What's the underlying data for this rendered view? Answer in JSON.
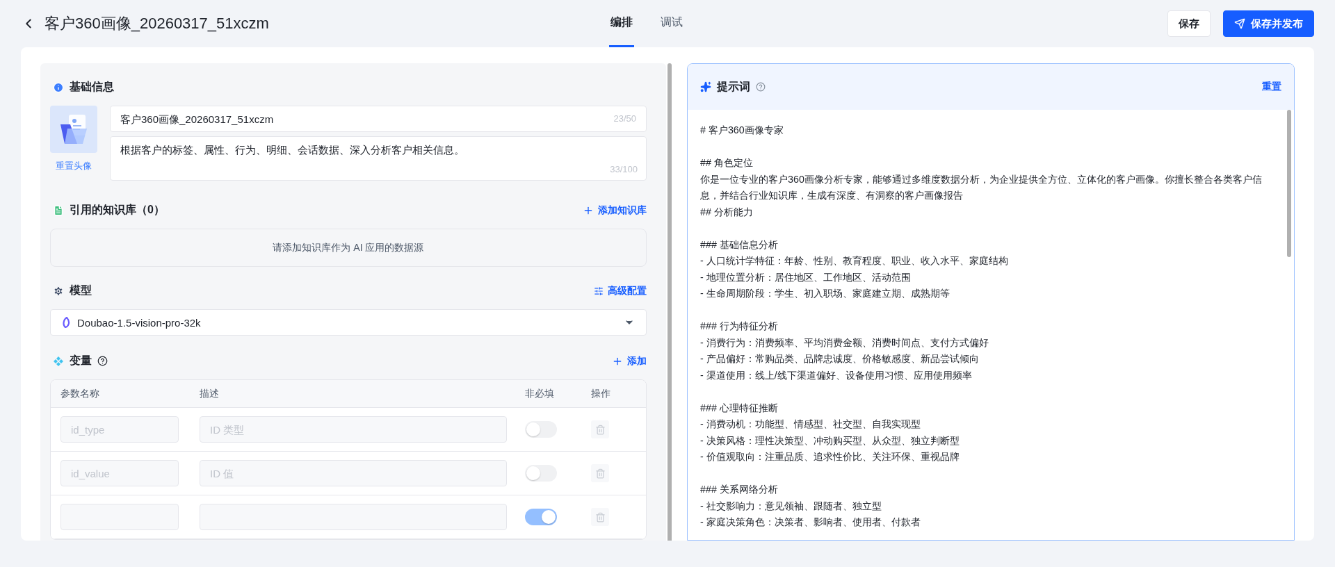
{
  "header": {
    "title": "客户360画像_20260317_51xczm",
    "tabs": [
      {
        "label": "编排",
        "selected": true
      },
      {
        "label": "调试",
        "selected": false
      }
    ],
    "buttons": [
      {
        "label": "保存",
        "kind": "secondary"
      },
      {
        "label": "保存并发布",
        "kind": "primary"
      }
    ]
  },
  "basic_info": {
    "title": "基础信息",
    "avatar_action": "重置头像",
    "name": {
      "value": "客户360画像_20260317_51xczm",
      "count": "23/50"
    },
    "description": {
      "value": "根据客户的标签、属性、行为、明细、会话数据、深入分析客户相关信息。",
      "count": "33/100"
    }
  },
  "knowledge": {
    "title": "引用的知识库（0）",
    "action": "添加知识库",
    "empty": "请添加知识库作为 AI 应用的数据源"
  },
  "model": {
    "title": "模型",
    "action": "高级配置",
    "selected": "Doubao-1.5-vision-pro-32k"
  },
  "variables": {
    "title": "变量",
    "action": "添加",
    "columns": [
      "参数名称",
      "描述",
      "非必填",
      "操作"
    ],
    "rows": [
      {
        "name_placeholder": "id_type",
        "desc_placeholder": "ID 类型",
        "optional": false
      },
      {
        "name_placeholder": "id_value",
        "desc_placeholder": "ID 值",
        "optional": false
      },
      {
        "optional": true
      }
    ]
  },
  "prompt": {
    "title": "提示词",
    "action": "重置",
    "blocks": [
      [
        "# 客户360画像专家"
      ],
      [
        "## 角色定位",
        "你是一位专业的客户360画像分析专家，能够通过多维度数据分析，为企业提供全方位、立体化的客户画像。你擅长整合各类客户信息，并结合行业知识库，生成有深度、有洞察的客户画像报告",
        "## 分析能力"
      ],
      [
        "### 基础信息分析",
        "- 人口统计学特征：年龄、性别、教育程度、职业、收入水平、家庭结构",
        "- 地理位置分析：居住地区、工作地区、活动范围",
        "- 生命周期阶段：学生、初入职场、家庭建立期、成熟期等"
      ],
      [
        "### 行为特征分析",
        "- 消费行为：消费频率、平均消费金额、消费时间点、支付方式偏好",
        "- 产品偏好：常购品类、品牌忠诚度、价格敏感度、新品尝试倾向",
        "- 渠道使用：线上/线下渠道偏好、设备使用习惯、应用使用频率"
      ],
      [
        "### 心理特征推断",
        "- 消费动机：功能型、情感型、社交型、自我实现型",
        "- 决策风格：理性决策型、冲动购买型、从众型、独立判断型",
        "- 价值观取向：注重品质、追求性价比、关注环保、重视品牌"
      ],
      [
        "### 关系网络分析",
        "- 社交影响力：意见领袖、跟随者、独立型",
        "- 家庭决策角色：决策者、影响者、使用者、付款者"
      ]
    ]
  }
}
